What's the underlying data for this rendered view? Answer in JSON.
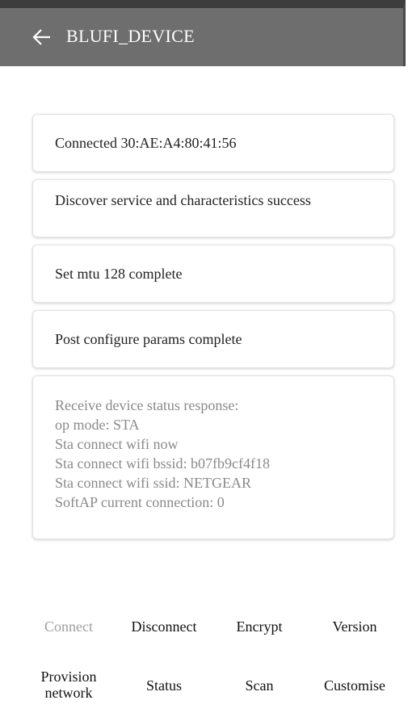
{
  "header": {
    "title": "BLUFI_DEVICE",
    "back_icon": "arrow-left-icon"
  },
  "messages": [
    "Connected 30:AE:A4:80:41:56",
    "Discover service and characteristics success",
    "Set mtu 128 complete",
    "Post configure params complete"
  ],
  "status": {
    "lines": [
      "Receive device status response:",
      "op mode: STA",
      "Sta connect wifi now",
      "Sta connect wifi bssid: b07fb9cf4f18",
      "Sta connect wifi ssid: NETGEAR",
      "SoftAP current connection: 0"
    ]
  },
  "buttons": {
    "row1": [
      "Connect",
      "Disconnect",
      "Encrypt",
      "Version"
    ],
    "provision_line1": "Provision",
    "provision_line2": "network",
    "row2": [
      "Status",
      "Scan",
      "Customise"
    ]
  },
  "colors": {
    "toolbar": "#6e6e6e",
    "status_bar": "#3d3d3d",
    "disabled_text": "#a0a0a0",
    "status_text": "#8a8a8a"
  }
}
